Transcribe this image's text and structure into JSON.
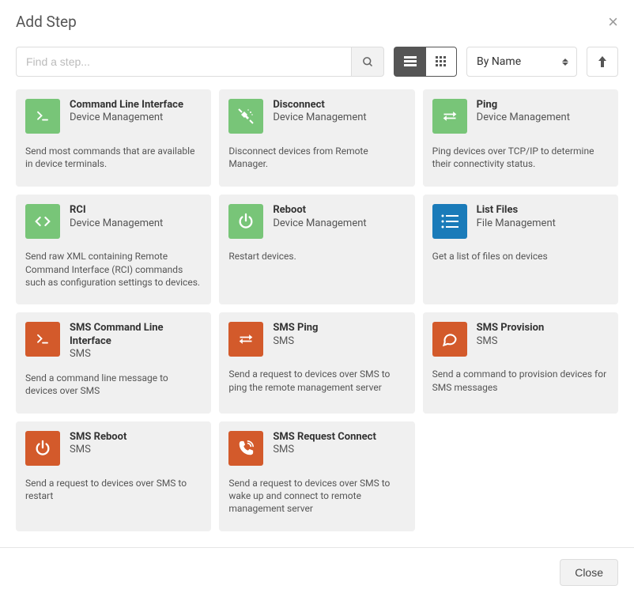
{
  "header": {
    "title": "Add Step"
  },
  "search": {
    "placeholder": "Find a step..."
  },
  "sort": {
    "selected": "By Name"
  },
  "footer": {
    "close_label": "Close"
  },
  "cards": [
    {
      "title": "Command Line Interface",
      "sub": "Device Management",
      "desc": "Send most commands that are available in device terminals.",
      "icon": "terminal",
      "color": "green"
    },
    {
      "title": "Disconnect",
      "sub": "Device Management",
      "desc": "Disconnect devices from Remote Manager.",
      "icon": "unplug",
      "color": "green"
    },
    {
      "title": "Ping",
      "sub": "Device Management",
      "desc": "Ping devices over TCP/IP to determine their connectivity status.",
      "icon": "exchange",
      "color": "green"
    },
    {
      "title": "RCI",
      "sub": "Device Management",
      "desc": "Send raw XML containing Remote Command Interface (RCI) commands such as configuration settings to devices.",
      "icon": "code",
      "color": "green"
    },
    {
      "title": "Reboot",
      "sub": "Device Management",
      "desc": "Restart devices.",
      "icon": "power",
      "color": "green"
    },
    {
      "title": "List Files",
      "sub": "File Management",
      "desc": "Get a list of files on devices",
      "icon": "list",
      "color": "blue"
    },
    {
      "title": "SMS Command Line Interface",
      "sub": "SMS",
      "desc": "Send a command line message to devices over SMS",
      "icon": "terminal",
      "color": "orange"
    },
    {
      "title": "SMS Ping",
      "sub": "SMS",
      "desc": "Send a request to devices over SMS to ping the remote management server",
      "icon": "exchange",
      "color": "orange"
    },
    {
      "title": "SMS Provision",
      "sub": "SMS",
      "desc": "Send a command to provision devices for SMS messages",
      "icon": "chat",
      "color": "orange"
    },
    {
      "title": "SMS Reboot",
      "sub": "SMS",
      "desc": "Send a request to devices over SMS to restart",
      "icon": "power",
      "color": "orange"
    },
    {
      "title": "SMS Request Connect",
      "sub": "SMS",
      "desc": "Send a request to devices over SMS to wake up and connect to remote management server",
      "icon": "phone",
      "color": "orange"
    }
  ],
  "icons": {
    "terminal": "terminal-icon",
    "unplug": "unplug-icon",
    "exchange": "exchange-icon",
    "code": "code-icon",
    "power": "power-icon",
    "list": "list-icon",
    "chat": "chat-icon",
    "phone": "phone-icon"
  }
}
